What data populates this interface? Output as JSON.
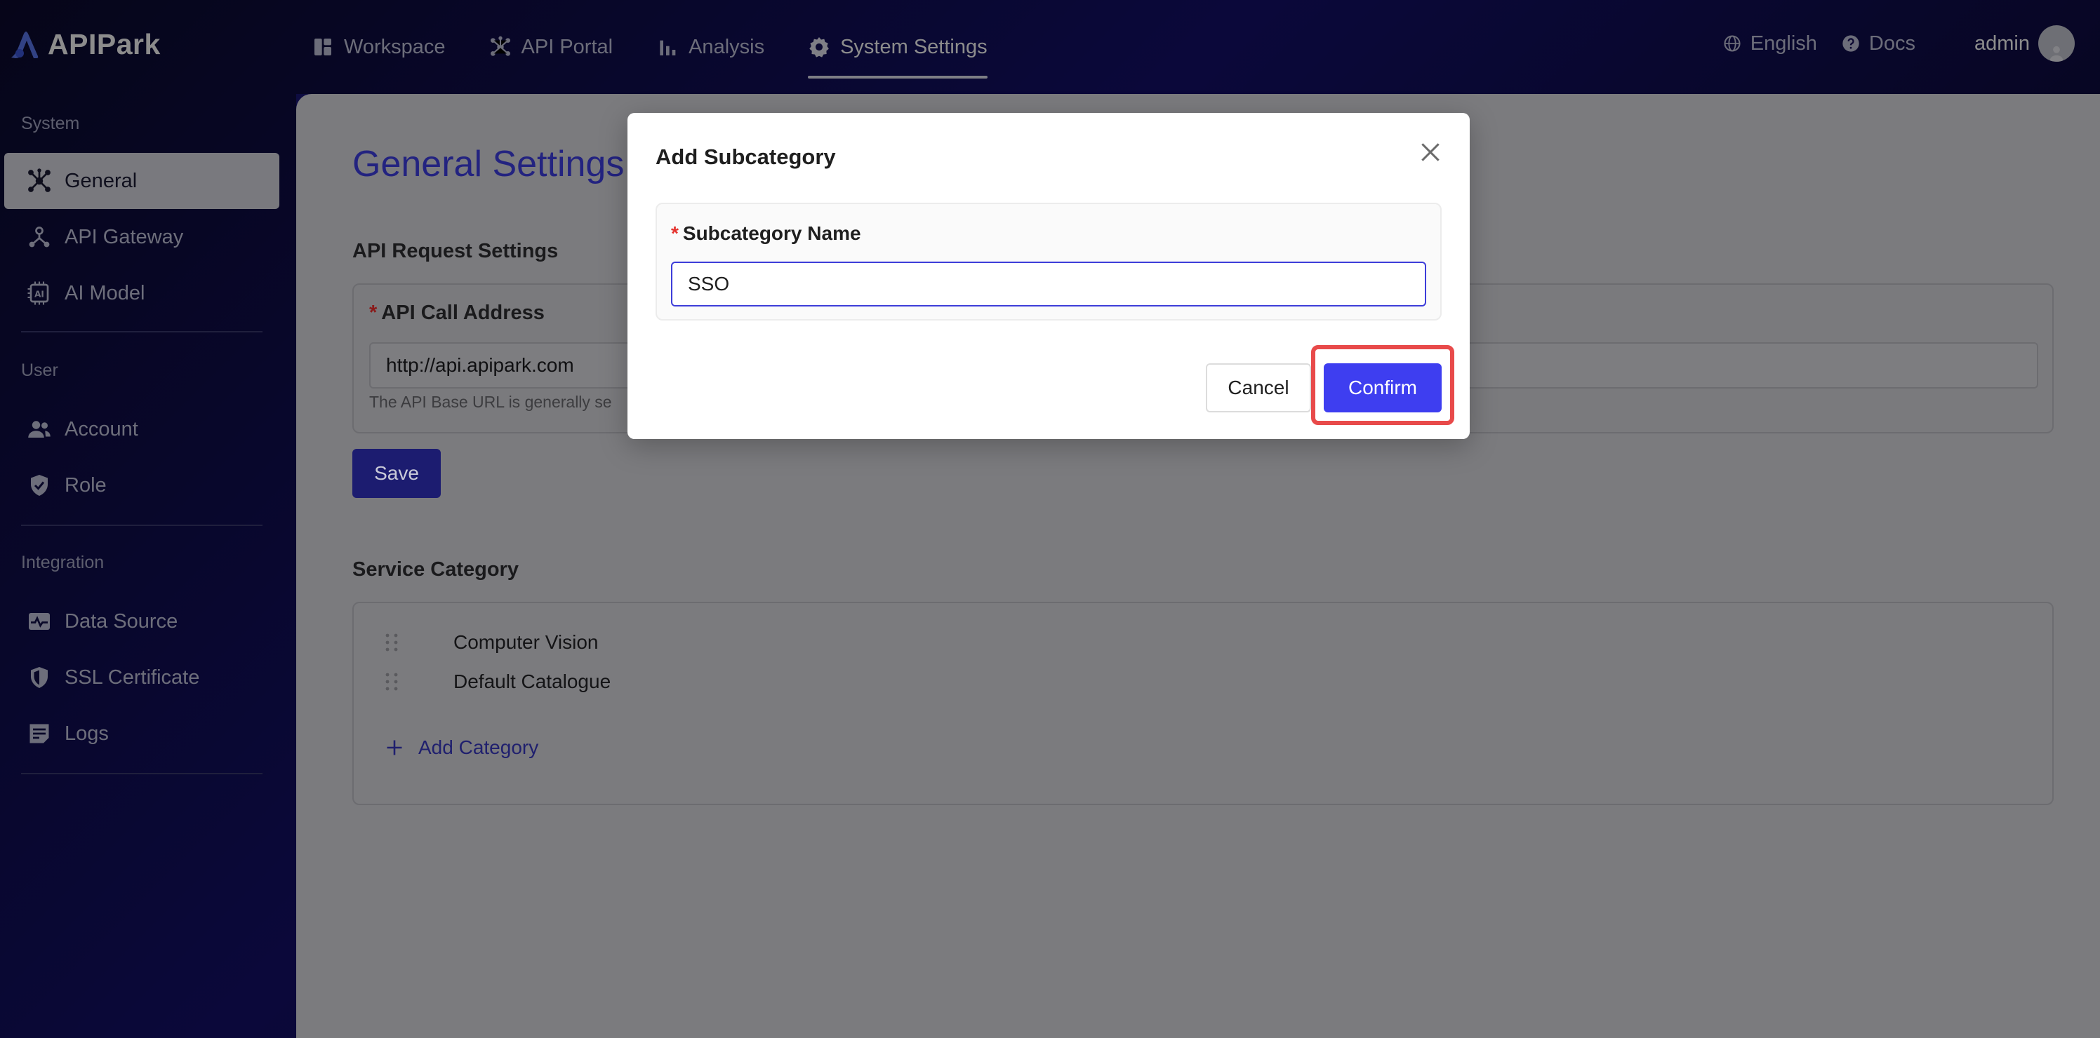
{
  "brand": {
    "name": "APIPark"
  },
  "topnav": {
    "items": [
      {
        "label": "Workspace",
        "icon": "dashboard-icon"
      },
      {
        "label": "API Portal",
        "icon": "network-icon"
      },
      {
        "label": "Analysis",
        "icon": "bar-chart-icon"
      },
      {
        "label": "System Settings",
        "icon": "gear-icon",
        "active": true
      }
    ]
  },
  "topright": {
    "language": "English",
    "docs": "Docs",
    "user": "admin"
  },
  "sidebar": {
    "sections": [
      {
        "title": "System",
        "items": [
          {
            "label": "General",
            "icon": "hub-icon",
            "active": true
          },
          {
            "label": "API Gateway",
            "icon": "gateway-icon"
          },
          {
            "label": "AI Model",
            "icon": "ai-model-icon"
          }
        ]
      },
      {
        "title": "User",
        "items": [
          {
            "label": "Account",
            "icon": "users-icon"
          },
          {
            "label": "Role",
            "icon": "shield-check-icon"
          }
        ]
      },
      {
        "title": "Integration",
        "items": [
          {
            "label": "Data Source",
            "icon": "data-source-icon"
          },
          {
            "label": "SSL Certificate",
            "icon": "shield-icon"
          },
          {
            "label": "Logs",
            "icon": "logs-icon"
          }
        ]
      }
    ]
  },
  "main": {
    "title": "General Settings",
    "api_request": {
      "section_title": "API Request Settings",
      "field_label": "API Call Address",
      "field_value": "http://api.apipark.com",
      "help_text": "The API Base URL is generally se",
      "save_label": "Save"
    },
    "service_category": {
      "section_title": "Service Category",
      "categories": [
        "Computer Vision",
        "Default Catalogue"
      ],
      "add_label": "Add Category"
    }
  },
  "modal": {
    "title": "Add Subcategory",
    "field_label": "Subcategory Name",
    "field_value": "SSO",
    "cancel_label": "Cancel",
    "confirm_label": "Confirm"
  },
  "colors": {
    "accent": "#3e3ef0",
    "highlight": "#e84a4a",
    "required": "#e5322d"
  }
}
